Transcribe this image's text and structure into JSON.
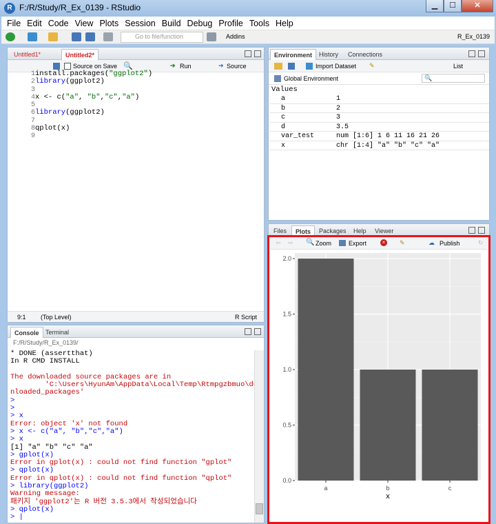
{
  "window": {
    "title": "F:/R/Study/R_Ex_0139 - RStudio",
    "app_icon": "R"
  },
  "menu": [
    "File",
    "Edit",
    "Code",
    "View",
    "Plots",
    "Session",
    "Build",
    "Debug",
    "Profile",
    "Tools",
    "Help"
  ],
  "toolbar": {
    "goto_placeholder": "Go to file/function",
    "addins": "Addins",
    "project": "R_Ex_0139"
  },
  "editor": {
    "tabs": [
      {
        "label": "Untitled1*",
        "active": false
      },
      {
        "label": "Untitled2*",
        "active": true
      }
    ],
    "source_on_save": "Source on Save",
    "run": "Run",
    "source": "Source",
    "lines": [
      {
        "n": "1",
        "text": "install.packages(\"ggplot2\")"
      },
      {
        "n": "2",
        "text": "library(ggplot2)"
      },
      {
        "n": "3",
        "text": ""
      },
      {
        "n": "4",
        "text": "x <- c(\"a\", \"b\",\"c\",\"a\")"
      },
      {
        "n": "5",
        "text": ""
      },
      {
        "n": "6",
        "text": "library(ggplot2)"
      },
      {
        "n": "7",
        "text": ""
      },
      {
        "n": "8",
        "text": "qplot(x)"
      },
      {
        "n": "9",
        "text": ""
      }
    ],
    "status_pos": "9:1",
    "status_level": "(Top Level)",
    "status_type": "R Script"
  },
  "console": {
    "tabs": [
      {
        "label": "Console",
        "active": true
      },
      {
        "label": "Terminal",
        "active": false
      }
    ],
    "path": "F:/R/Study/R_Ex_0139/",
    "lines": [
      {
        "t": "* DONE (assertthat)",
        "c": "black"
      },
      {
        "t": "In R CMD INSTALL",
        "c": "black"
      },
      {
        "t": "",
        "c": "black"
      },
      {
        "t": "The downloaded source packages are in",
        "c": "red"
      },
      {
        "t": "        'C:\\Users\\HyunAm\\AppData\\Local\\Temp\\Rtmpgzbmuo\\dow",
        "c": "red"
      },
      {
        "t": "nloaded_packages'",
        "c": "red"
      },
      {
        "t": ">",
        "c": "blue"
      },
      {
        "t": ">",
        "c": "blue"
      },
      {
        "t": "> x",
        "c": "blue"
      },
      {
        "t": "Error: object 'x' not found",
        "c": "red"
      },
      {
        "t": "> x <- c(\"a\", \"b\",\"c\",\"a\")",
        "c": "blue"
      },
      {
        "t": "> x",
        "c": "blue"
      },
      {
        "t": "[1] \"a\" \"b\" \"c\" \"a\"",
        "c": "black"
      },
      {
        "t": "> gplot(x)",
        "c": "blue"
      },
      {
        "t": "Error in gplot(x) : could not find function \"gplot\"",
        "c": "red"
      },
      {
        "t": "> qplot(x)",
        "c": "blue"
      },
      {
        "t": "Error in qplot(x) : could not find function \"qplot\"",
        "c": "red"
      },
      {
        "t": "> library(ggplot2)",
        "c": "blue"
      },
      {
        "t": "Warning message:",
        "c": "red"
      },
      {
        "t": "패키지 'ggplot2'는 R 버전 3.5.3에서 작성되었습니다",
        "c": "red"
      },
      {
        "t": "> qplot(x)",
        "c": "blue"
      },
      {
        "t": "> |",
        "c": "blue"
      }
    ]
  },
  "environment": {
    "tabs": [
      {
        "label": "Environment",
        "active": true
      },
      {
        "label": "History",
        "active": false
      },
      {
        "label": "Connections",
        "active": false
      }
    ],
    "import_dataset": "Import Dataset",
    "list_view": "List",
    "scope": "Global Environment",
    "section": "Values",
    "rows": [
      {
        "name": "a",
        "value": "1"
      },
      {
        "name": "b",
        "value": "2"
      },
      {
        "name": "c",
        "value": "3"
      },
      {
        "name": "d",
        "value": "3.5"
      },
      {
        "name": "var_test",
        "value": "num [1:6] 1 6 11 16 21 26"
      },
      {
        "name": "x",
        "value": "chr [1:4] \"a\" \"b\" \"c\" \"a\""
      }
    ]
  },
  "files": {
    "tabs": [
      {
        "label": "Files",
        "active": false
      },
      {
        "label": "Plots",
        "active": true
      },
      {
        "label": "Packages",
        "active": false
      },
      {
        "label": "Help",
        "active": false
      },
      {
        "label": "Viewer",
        "active": false
      }
    ],
    "zoom": "Zoom",
    "export": "Export",
    "publish": "Publish"
  },
  "chart_data": {
    "type": "bar",
    "categories": [
      "a",
      "b",
      "c"
    ],
    "values": [
      2,
      1,
      1
    ],
    "xlabel": "x",
    "ylabel": "",
    "ylim": [
      0,
      2.05
    ],
    "yticks": [
      "0.0",
      "0.5",
      "1.0",
      "1.5",
      "2.0"
    ],
    "grid": true,
    "bar_color": "#595959",
    "panel_bg": "#ebebeb"
  },
  "highlight_color": "#e8121a"
}
